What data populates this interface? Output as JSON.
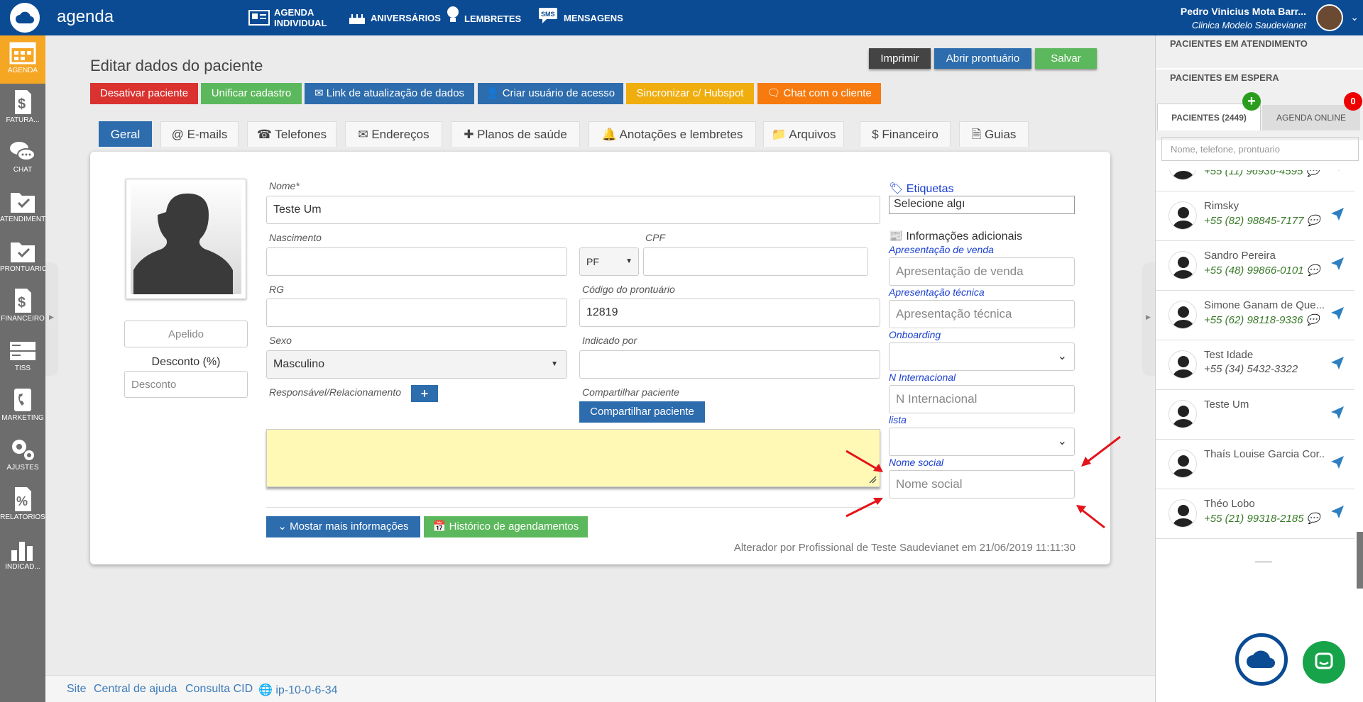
{
  "header": {
    "app_title": "agenda",
    "nav": [
      {
        "label": "AGENDA\nINDIVIDUAL",
        "icon": "calendar-card-icon"
      },
      {
        "label": "ANIVERSÁRIOS",
        "icon": "cake-icon"
      },
      {
        "label": "LEMBRETES",
        "icon": "lightbulb-icon"
      },
      {
        "label": "MENSAGENS",
        "icon": "sms-icon"
      }
    ],
    "nav_labels": {
      "agenda_1": "AGENDA",
      "agenda_2": "INDIVIDUAL",
      "aniversarios": "ANIVERSÁRIOS",
      "lembretes": "LEMBRETES",
      "mensagens": "MENSAGENS"
    },
    "user_name": "Pedro Vinicius Mota Barr...",
    "clinic": "Clinica Modelo Saudevianet"
  },
  "sidebar": {
    "items": [
      {
        "label": "AGENDA",
        "icon": "calendar-icon"
      },
      {
        "label": "FATURA...",
        "icon": "dollar-doc-icon"
      },
      {
        "label": "CHAT",
        "icon": "chat-icon"
      },
      {
        "label": "ATENDIMENTO",
        "icon": "folder-check-icon"
      },
      {
        "label": "PRONTUÁRIO",
        "icon": "folder-check-icon"
      },
      {
        "label": "FINANCEIRO",
        "icon": "dollar-doc-icon"
      },
      {
        "label": "TISS",
        "icon": "cards-icon"
      },
      {
        "label": "MARKETING",
        "icon": "phone-icon"
      },
      {
        "label": "AJUSTES",
        "icon": "gears-icon"
      },
      {
        "label": "RELATÓRIOS",
        "icon": "percent-doc-icon"
      },
      {
        "label": "INDICAD...",
        "icon": "bar-chart-icon"
      }
    ]
  },
  "page": {
    "title": "Editar dados do paciente",
    "top_buttons": {
      "print": "Imprimir",
      "open_record": "Abrir prontuário",
      "save": "Salvar"
    },
    "actions": {
      "deactivate": "Desativar paciente",
      "merge": "Unificar cadastro",
      "update_link": "Link de atualização de dados",
      "create_user": "Criar usuário de acesso",
      "sync_hubspot": "Sincronizar c/ Hubspot",
      "chat_client": "Chat com o cliente"
    },
    "tabs": [
      "Geral",
      "E-mails",
      "Telefones",
      "Endereços",
      "Planos de saúde",
      "Anotações e lembretes",
      "Arquivos",
      "Financeiro",
      "Guias"
    ]
  },
  "form": {
    "nome_label": "Nome*",
    "nome_value": "Teste Um",
    "nascimento_label": "Nascimento",
    "cpf_label": "CPF",
    "cpf_type": "PF",
    "rg_label": "RG",
    "codigo_label": "Código do prontuário",
    "codigo_value": "12819",
    "sexo_label": "Sexo",
    "sexo_value": "Masculino",
    "indicado_label": "Indicado por",
    "responsavel_label": "Responsável/Relacionamento",
    "compartilhar_label": "Compartilhar paciente",
    "compartilhar_button": "Compartilhar paciente",
    "apelido_placeholder": "Apelido",
    "desconto_label": "Desconto (%)",
    "desconto_placeholder": "Desconto",
    "more_info_button": "Mostar mais informações",
    "history_button": "Histórico de agendamentos",
    "altered_by": "Alterador por Profissional de Teste Saudevianet em 21/06/2019 11:11:30"
  },
  "extras": {
    "etiquetas_label": "Etiquetas",
    "etiquetas_placeholder": "Selecione algı",
    "info_title": "Informações adicionais",
    "fields": [
      {
        "label": "Apresentação de venda",
        "placeholder": "Apresentação de venda"
      },
      {
        "label": "Apresentação técnica",
        "placeholder": "Apresentação técnica"
      },
      {
        "label": "Onboarding",
        "placeholder": ""
      },
      {
        "label": "N Internacional",
        "placeholder": "N Internacional"
      },
      {
        "label": "lista",
        "placeholder": ""
      },
      {
        "label": "Nome social",
        "placeholder": "Nome social"
      }
    ]
  },
  "right_panel": {
    "in_service": "PACIENTES EM ATENDIMENTO",
    "waiting": "PACIENTES EM ESPERA",
    "tab_patients": "PACIENTES (2449)",
    "tab_online": "AGENDA ONLINE",
    "online_badge": "0",
    "search_placeholder": "Nome, telefone, prontuario",
    "patients": [
      {
        "name": "",
        "phone": "+55 (11) 96936-4595"
      },
      {
        "name": "Rimsky",
        "phone": "+55 (82) 98845-7177"
      },
      {
        "name": "Sandro Pereira",
        "phone": "+55 (48) 99866-0101"
      },
      {
        "name": "Simone Ganam de Que...",
        "phone": "+55 (62) 98118-9336"
      },
      {
        "name": "Test Idade",
        "phone": "+55 (34) 5432-3322"
      },
      {
        "name": "Teste Um",
        "phone": ""
      },
      {
        "name": "Thaís Louise Garcia Cor...",
        "phone": ""
      },
      {
        "name": "Théo Lobo",
        "phone": "+55 (21) 99318-2185"
      }
    ]
  },
  "footer": {
    "links": [
      "Site",
      "Central de ajuda",
      "Consulta CID"
    ],
    "ip": "ip-10-0-6-34"
  },
  "colors": {
    "header": "#0a4b94",
    "danger": "#d9322f",
    "success": "#5cb85c",
    "primary": "#2d6cad",
    "warning": "#f0ad0e",
    "orange": "#f77a0e",
    "dark": "#444444"
  }
}
